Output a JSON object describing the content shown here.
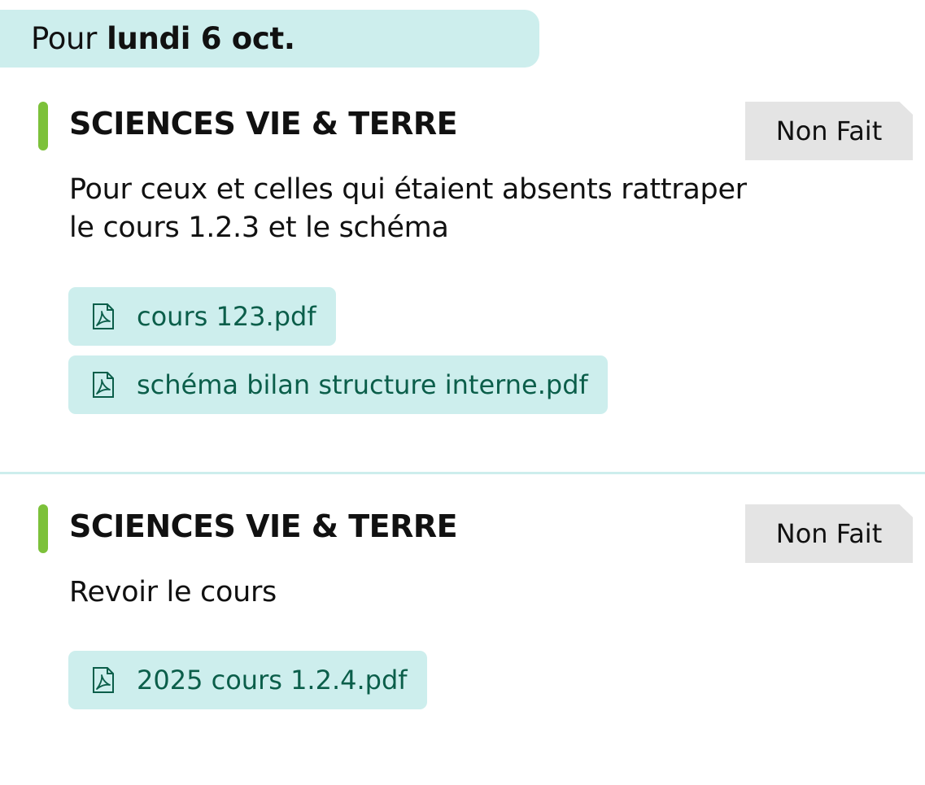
{
  "header": {
    "prefix": "Pour",
    "date": "lundi 6 oct."
  },
  "homework": [
    {
      "subject": "SCIENCES VIE & TERRE",
      "status": "Non Fait",
      "description_lines": [
        "Pour ceux et celles qui étaient absents rattraper",
        "le cours 1.2.3 et le schéma"
      ],
      "attachments": [
        {
          "name": "cours 123.pdf",
          "icon": "pdf-file-icon"
        },
        {
          "name": "schéma bilan structure interne.pdf",
          "icon": "pdf-file-icon"
        }
      ]
    },
    {
      "subject": "SCIENCES VIE & TERRE",
      "status": "Non Fait",
      "description_lines": [
        "Revoir le cours"
      ],
      "attachments": [
        {
          "name": "2025 cours 1.2.4.pdf",
          "icon": "pdf-file-icon"
        }
      ]
    }
  ],
  "colors": {
    "accent_bar": "#7cc13a",
    "header_bg": "#cdeeed",
    "attachment_bg": "#cdeeed",
    "attachment_text": "#0b5e4a",
    "status_bg": "#e4e4e4"
  }
}
